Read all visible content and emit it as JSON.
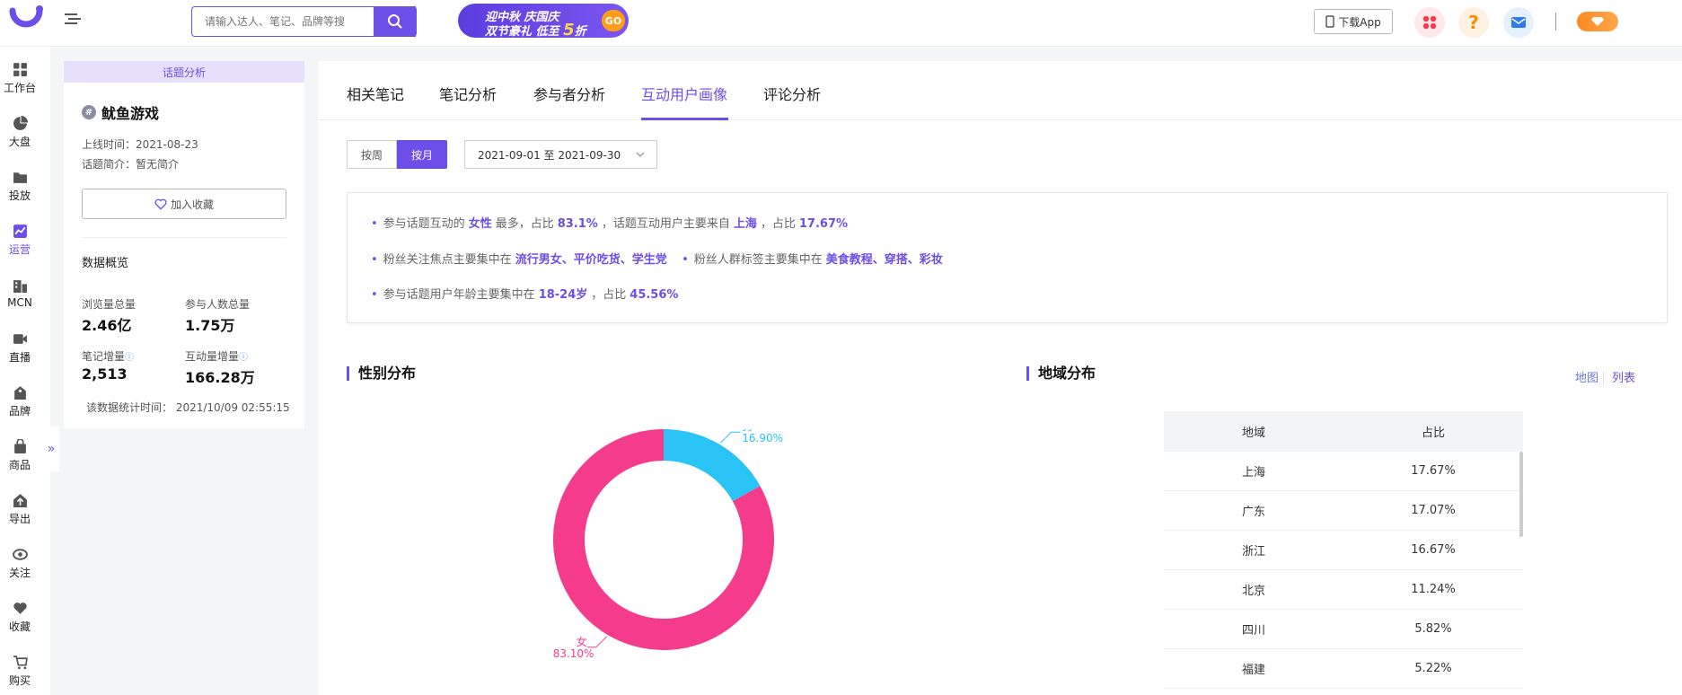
{
  "header": {
    "search_placeholder": "请输入达人、笔记、品牌等搜",
    "promo": {
      "line1": "迎中秋 庆国庆",
      "line2_prefix": "双节豪礼 低至",
      "line2_big": "5",
      "line2_suffix": "折",
      "go": "GO"
    },
    "download_app": "下载App",
    "help": "?"
  },
  "nav": {
    "items": [
      {
        "label": "工作台",
        "icon": "dashboard-icon"
      },
      {
        "label": "大盘",
        "icon": "pie-chart-icon"
      },
      {
        "label": "投放",
        "icon": "folder-icon"
      },
      {
        "label": "运营",
        "icon": "trend-icon"
      },
      {
        "label": "MCN",
        "icon": "building-icon"
      },
      {
        "label": "直播",
        "icon": "video-icon"
      },
      {
        "label": "品牌",
        "icon": "tag-icon"
      },
      {
        "label": "商品",
        "icon": "bag-icon"
      },
      {
        "label": "导出",
        "icon": "export-icon"
      },
      {
        "label": "关注",
        "icon": "eye-icon"
      },
      {
        "label": "收藏",
        "icon": "heart-icon"
      },
      {
        "label": "购买",
        "icon": "cart-icon"
      }
    ],
    "active_index": 3,
    "collapse": "»"
  },
  "topic": {
    "header": "话题分析",
    "hash": "#",
    "name": "鱿鱼游戏",
    "online_time": "上线时间：2021-08-23",
    "intro": "话题简介：暂无简介",
    "fav_label": "加入收藏",
    "overview_title": "数据概览",
    "stats": {
      "views_label": "浏览量总量",
      "views_value": "2.46亿",
      "participants_label": "参与人数总量",
      "participants_value": "1.75万",
      "notes_label": "笔记增量",
      "notes_value": "2,513",
      "interactions_label": "互动量增量",
      "interactions_value": "166.28万"
    },
    "stat_time": "该数据统计时间：  2021/10/09 02:55:15"
  },
  "tabs": {
    "items": [
      "相关笔记",
      "笔记分析",
      "参与者分析",
      "互动用户画像",
      "评论分析"
    ],
    "active": "互动用户画像"
  },
  "filters": {
    "week": "按周",
    "month": "按月",
    "date_range": "2021-09-01 至 2021-09-30"
  },
  "summary": {
    "line1": {
      "t1": "参与话题互动的",
      "h1": "女性",
      "t2": "最多，占比",
      "h2": "83.1%",
      "t3": "，话题互动用户主要来自",
      "h3": "上海",
      "t4": "，占比",
      "h4": "17.67%"
    },
    "line2": {
      "t1": "粉丝关注焦点主要集中在",
      "h1": "流行男女、平价吃货、学生党",
      "t2": "粉丝人群标签主要集中在",
      "h2": "美食教程、穿搭、彩妆"
    },
    "line3": {
      "t1": "参与话题用户年龄主要集中在",
      "h1": "18-24岁",
      "t2": "，占比",
      "h2": "45.56%"
    }
  },
  "gender": {
    "title": "性别分布",
    "male_label": "男",
    "male_pct": "16.90%",
    "female_label": "女",
    "female_pct": "83.10%"
  },
  "region": {
    "title": "地域分布",
    "view_map": "地图",
    "view_list": "列表",
    "columns": [
      "地域",
      "占比"
    ],
    "rows": [
      [
        "上海",
        "17.67%"
      ],
      [
        "广东",
        "17.07%"
      ],
      [
        "浙江",
        "16.67%"
      ],
      [
        "北京",
        "11.24%"
      ],
      [
        "四川",
        "5.82%"
      ],
      [
        "福建",
        "5.22%"
      ]
    ]
  },
  "chart_data": {
    "type": "pie",
    "categories": [
      "男",
      "女"
    ],
    "values": [
      16.9,
      83.1
    ],
    "colors": [
      "#29c3f5",
      "#f53b8c"
    ],
    "title": "性别分布"
  },
  "colors": {
    "accent": "#6c4ee8",
    "male": "#29c3f5",
    "female": "#f53b8c"
  }
}
